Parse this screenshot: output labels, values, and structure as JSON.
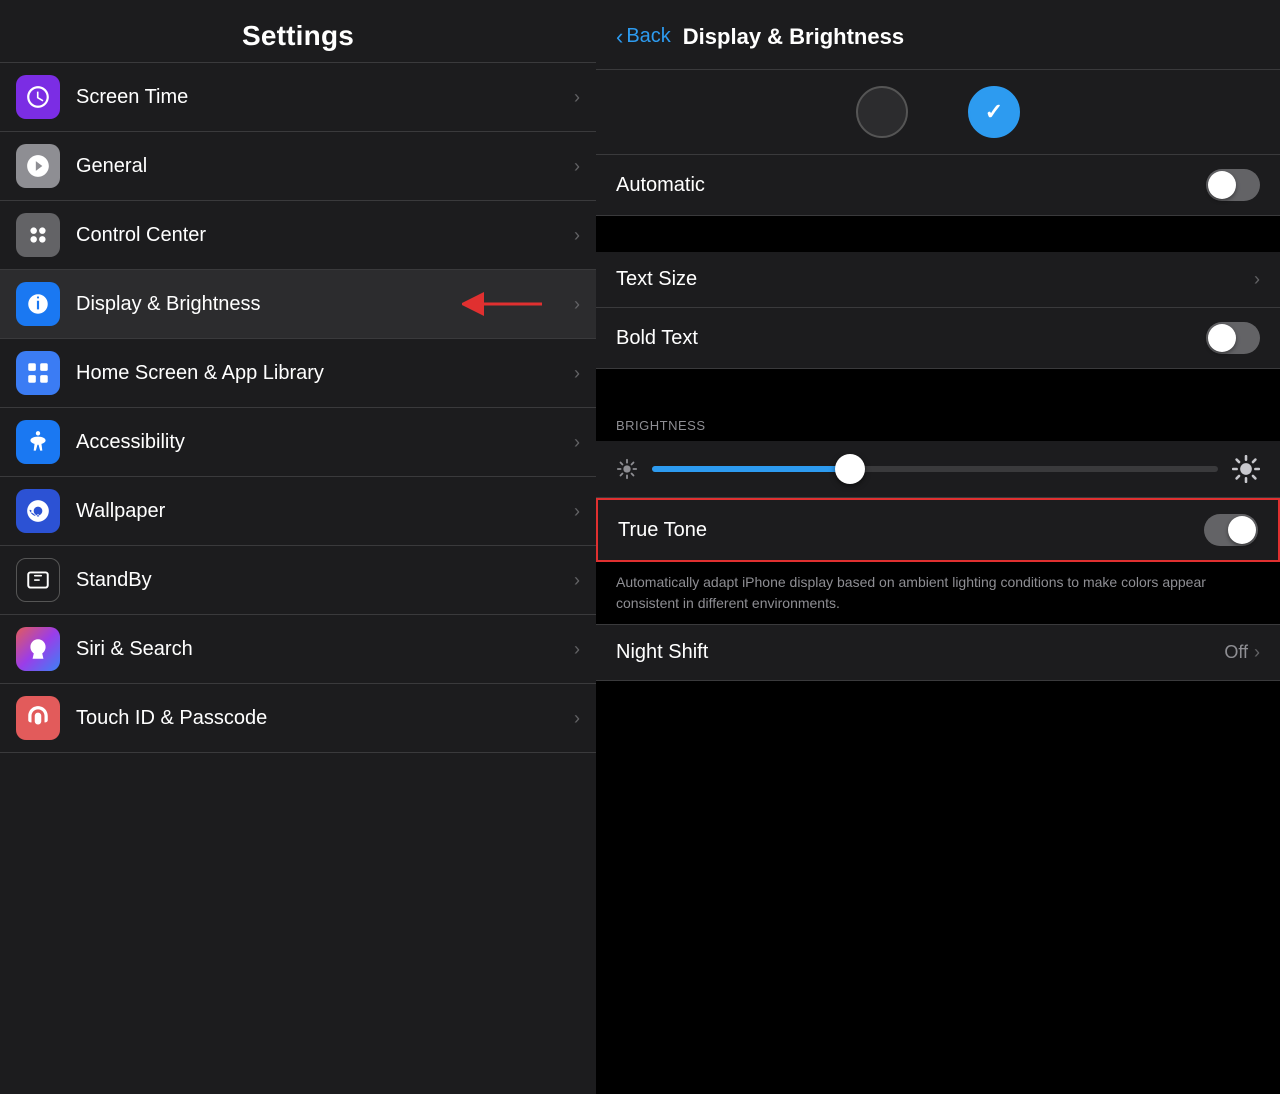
{
  "left": {
    "title": "Settings",
    "items": [
      {
        "id": "screen-time",
        "label": "Screen Time",
        "iconClass": "icon-screen-time",
        "iconColor": "#7b2de4"
      },
      {
        "id": "general",
        "label": "General",
        "iconClass": "icon-general",
        "iconColor": "#8e8e93"
      },
      {
        "id": "control-center",
        "label": "Control Center",
        "iconClass": "icon-control-center",
        "iconColor": "#636366"
      },
      {
        "id": "display",
        "label": "Display & Brightness",
        "iconClass": "icon-display",
        "iconColor": "#1a78f2",
        "highlighted": true
      },
      {
        "id": "homescreen",
        "label": "Home Screen & App Library",
        "iconClass": "icon-homescreen",
        "iconColor": "#3b7cf4"
      },
      {
        "id": "accessibility",
        "label": "Accessibility",
        "iconClass": "icon-accessibility",
        "iconColor": "#1a78f2"
      },
      {
        "id": "wallpaper",
        "label": "Wallpaper",
        "iconClass": "icon-wallpaper",
        "iconColor": "#2c52d4"
      },
      {
        "id": "standby",
        "label": "StandBy",
        "iconClass": "icon-standby"
      },
      {
        "id": "siri",
        "label": "Siri & Search",
        "iconClass": "icon-siri"
      },
      {
        "id": "touchid",
        "label": "Touch ID & Passcode",
        "iconClass": "icon-touchid",
        "iconColor": "#e25b5b"
      }
    ]
  },
  "right": {
    "back_label": "Back",
    "title": "Display & Brightness",
    "appearance": {
      "light_selected": false,
      "dark_selected": true
    },
    "automatic": {
      "label": "Automatic",
      "on": false
    },
    "text_size": {
      "label": "Text Size"
    },
    "bold_text": {
      "label": "Bold Text",
      "on": false
    },
    "brightness_section_label": "BRIGHTNESS",
    "brightness_value": 35,
    "true_tone": {
      "label": "True Tone",
      "on": false
    },
    "true_tone_description": "Automatically adapt iPhone display based on ambient lighting conditions to make colors appear consistent in different environments.",
    "night_shift": {
      "label": "Night Shift",
      "value": "Off"
    }
  }
}
